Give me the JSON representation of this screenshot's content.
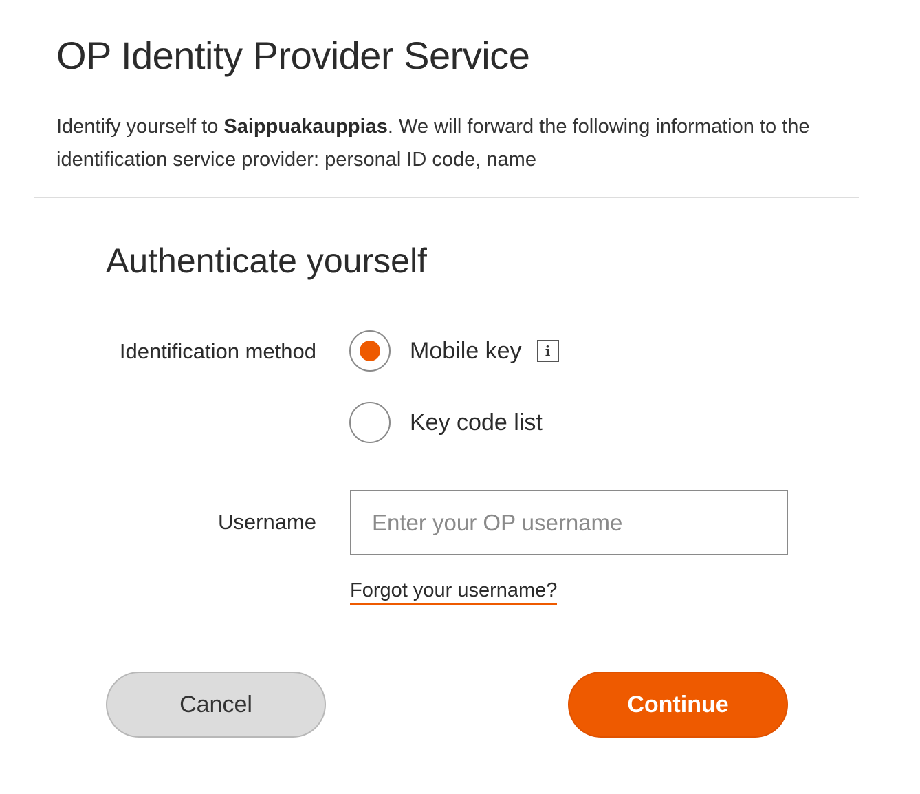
{
  "header": {
    "title": "OP Identity Provider Service",
    "intro_prefix": "Identify yourself to ",
    "service_name": "Saippuakauppias",
    "intro_suffix": ". We will forward the following information to the identification service provider: personal ID code, name"
  },
  "auth": {
    "title": "Authenticate yourself",
    "method_label": "Identification method",
    "methods": [
      {
        "label": "Mobile key",
        "selected": true,
        "has_info": true
      },
      {
        "label": "Key code list",
        "selected": false,
        "has_info": false
      }
    ],
    "info_glyph": "i",
    "username_label": "Username",
    "username_placeholder": "Enter your OP username",
    "username_value": "",
    "forgot_link": "Forgot your username?"
  },
  "buttons": {
    "cancel": "Cancel",
    "continue": "Continue"
  },
  "colors": {
    "accent": "#ee5a00",
    "cancel_bg": "#dcdcdc"
  }
}
